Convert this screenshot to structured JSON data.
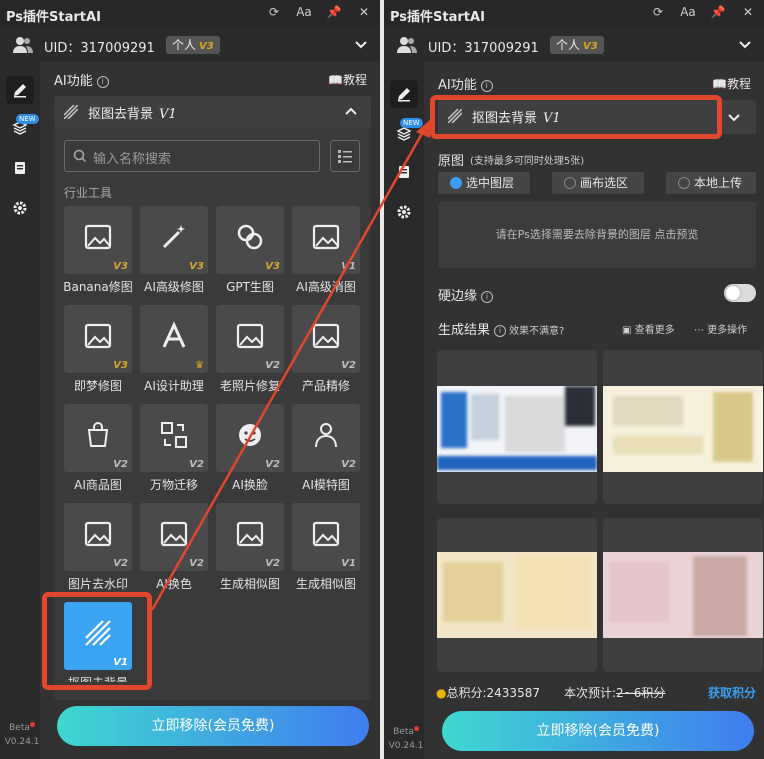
{
  "app": {
    "title": "Ps插件StartAI",
    "uid_text": "UID：317009291",
    "plan_label": "个人",
    "plan_version": "V3",
    "font_btn_label": "Aa"
  },
  "sidebar": {
    "new_tag": "NEW",
    "beta_label": "Beta",
    "version": "V0.24.1"
  },
  "left": {
    "section_title": "AI功能",
    "tutorial_label": "教程",
    "dropdown_label": "抠图去背景",
    "dropdown_version": "V1",
    "search_placeholder": "输入名称搜索",
    "category": "行业工具",
    "tools": [
      {
        "label": "Banana修图",
        "version": "V3"
      },
      {
        "label": "AI高级修图",
        "version": "V3"
      },
      {
        "label": "GPT生图",
        "version": "V3"
      },
      {
        "label": "AI高级消图",
        "version": "V1"
      },
      {
        "label": "即梦修图",
        "version": "V3"
      },
      {
        "label": "AI设计助理",
        "version": ""
      },
      {
        "label": "老照片修复",
        "version": "V2"
      },
      {
        "label": "产品精修",
        "version": "V2"
      },
      {
        "label": "AI商品图",
        "version": "V2"
      },
      {
        "label": "万物迁移",
        "version": "V2"
      },
      {
        "label": "AI换脸",
        "version": "V2"
      },
      {
        "label": "AI模特图",
        "version": "V2"
      },
      {
        "label": "图片去水印",
        "version": "V2"
      },
      {
        "label": "AI换色",
        "version": "V2"
      },
      {
        "label": "生成相似图",
        "version": "V2"
      },
      {
        "label": "生成相似图",
        "version": "V1"
      },
      {
        "label": "抠图去背景",
        "version": "V1"
      }
    ],
    "action_button": "立即移除(会员免费)"
  },
  "right": {
    "section_title": "AI功能",
    "tutorial_label": "教程",
    "dropdown_label": "抠图去背景",
    "dropdown_version": "V1",
    "source_title": "原图",
    "source_hint": "(支持最多可同时处理5张)",
    "source_options": [
      "选中图层",
      "画布选区",
      "本地上传"
    ],
    "drop_hint": "请在Ps选择需要去除背景的图层 点击预览",
    "hard_edge_label": "硬边缘",
    "results_title": "生成结果",
    "results_feedback": "效果不满意?",
    "view_more": "查看更多",
    "more_actions": "更多操作",
    "points_total": "总积分:2433587",
    "points_estimate_prefix": "本次预计:",
    "points_estimate_value": "2~6积分",
    "get_points": "获取积分",
    "action_button": "立即移除(会员免费)"
  },
  "colors": {
    "accent_blue": "#3ba5f4",
    "version_gold": "#d6a72b",
    "highlight_red": "#e0472c",
    "link_blue": "#3b9ef0"
  }
}
